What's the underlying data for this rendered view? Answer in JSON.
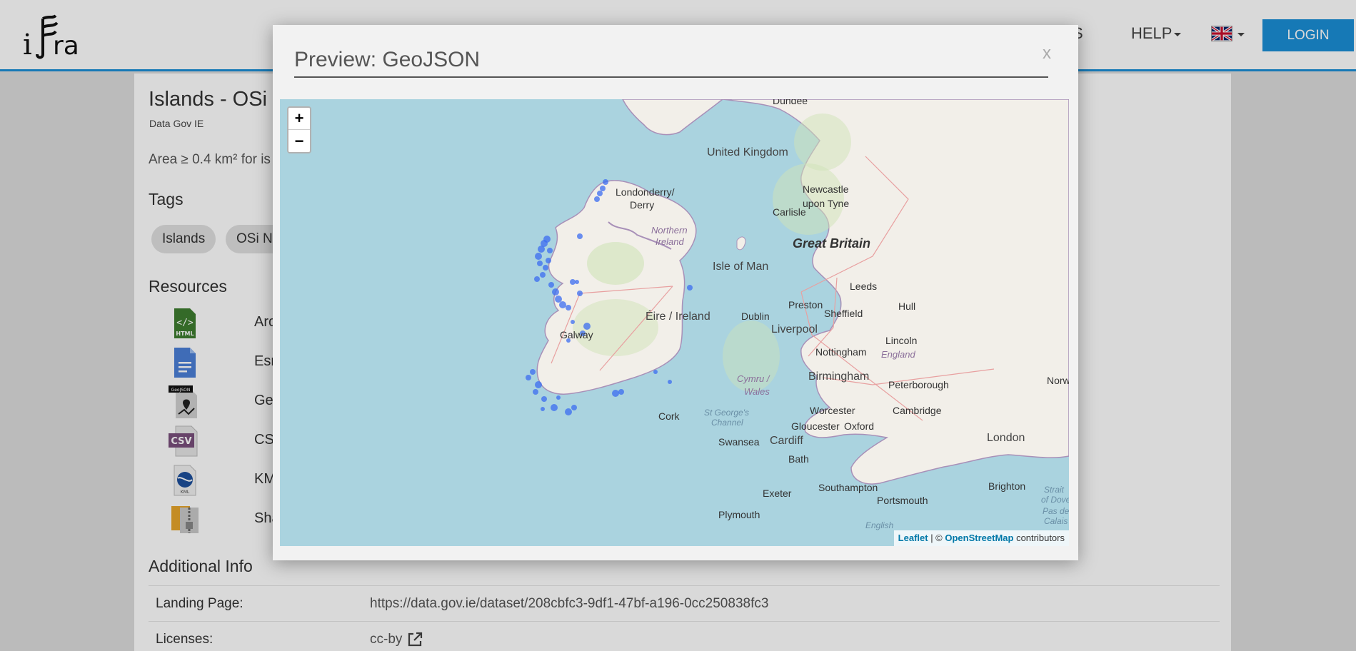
{
  "header": {
    "nav_stats": "STATISTICS",
    "nav_stats_visible": "ICS",
    "nav_help": "HELP",
    "login_label": "LOGIN"
  },
  "dataset": {
    "title": "Islands - OSi",
    "publisher": "Data Gov IE",
    "description": "Area ≥ 0.4 km² for is",
    "tags_heading": "Tags",
    "tags": [
      "Islands",
      "OSi Na"
    ],
    "resources_heading": "Resources",
    "resources": [
      {
        "name": "Arc",
        "icon": "html-file-icon"
      },
      {
        "name": "Esri",
        "icon": "document-file-icon"
      },
      {
        "name": "Geo",
        "icon": "geojson-file-icon"
      },
      {
        "name": "CSV",
        "icon": "csv-file-icon"
      },
      {
        "name": "KM",
        "icon": "kml-file-icon"
      },
      {
        "name": "Sha",
        "icon": "zip-file-icon"
      }
    ],
    "additional_heading": "Additional Info",
    "info": [
      {
        "label": "Landing Page:",
        "value": "https://data.gov.ie/dataset/208cbfc3-9df1-47bf-a196-0cc250838fc3"
      },
      {
        "label": "Licenses:",
        "value": "cc-by"
      }
    ]
  },
  "modal": {
    "title": "Preview: GeoJSON",
    "close_label": "x"
  },
  "map": {
    "zoom_in": "+",
    "zoom_out": "−",
    "attribution_leaflet": "Leaflet",
    "attribution_sep": " | © ",
    "attribution_osm": "OpenStreetMap",
    "attribution_tail": " contributors",
    "point_color": "#3b6cf0",
    "labels": {
      "dundee": "Dundee",
      "uk": "United Kingdom",
      "londonderry_1": "Londonderry/",
      "londonderry_2": "Derry",
      "newcastle_1": "Newcastle",
      "newcastle_2": "upon Tyne",
      "carlisle": "Carlisle",
      "ni_1": "Northern",
      "ni_2": "Ireland",
      "gb": "Great Britain",
      "iom": "Isle of Man",
      "leeds": "Leeds",
      "preston": "Preston",
      "hull": "Hull",
      "sheffield": "Sheffield",
      "eire": "Éire / Ireland",
      "dublin": "Dublin",
      "liverpool": "Liverpool",
      "galway": "Galway",
      "lincoln": "Lincoln",
      "nottingham": "Nottingham",
      "england": "England",
      "birmingham": "Birmingham",
      "cymru_1": "Cymru /",
      "cymru_2": "Wales",
      "peterborough": "Peterborough",
      "norw": "Norw",
      "worcester": "Worcester",
      "cambridge": "Cambridge",
      "cork": "Cork",
      "stgeorge_1": "St George's",
      "stgeorge_2": "Channel",
      "gloucester": "Gloucester",
      "oxford": "Oxford",
      "swansea": "Swansea",
      "cardiff": "Cardiff",
      "london": "London",
      "bath": "Bath",
      "exeter": "Exeter",
      "southampton": "Southampton",
      "brighton": "Brighton",
      "portsmouth": "Portsmouth",
      "plymouth": "Plymouth",
      "strait_1": "Strait",
      "strait_2": "of Dover",
      "strait_3": "Pas de",
      "strait_4": "Calais",
      "english": "English"
    }
  }
}
